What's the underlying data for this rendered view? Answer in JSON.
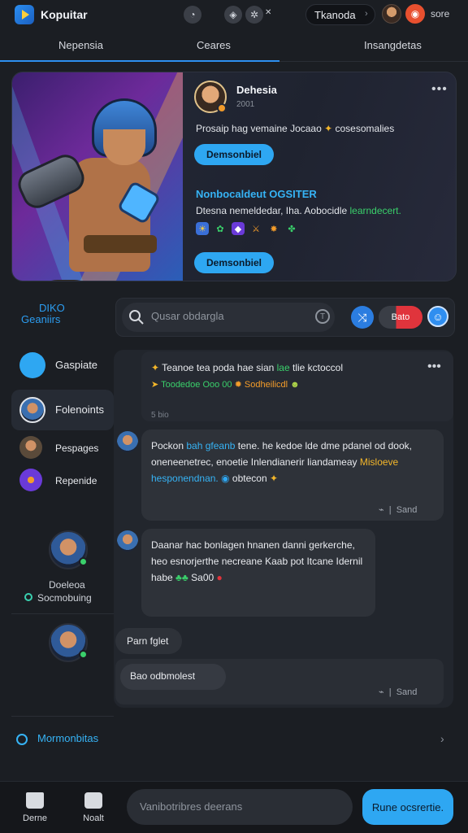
{
  "app": {
    "title": "Kopuitar"
  },
  "topbar": {
    "user_name": "Tkanoda",
    "notif_label": "sore"
  },
  "tabs": [
    {
      "label": "Nepensia"
    },
    {
      "label": "Ceares"
    },
    {
      "label": "Insangdetas"
    }
  ],
  "hero": {
    "name": "Dehesia",
    "sub": "2001",
    "description": "Prosaip hag vemaine Jocaao",
    "description_tail": "cosesomalies",
    "button1": "Demsonbiel",
    "heading2": "Nonbocaldeut OGSITER",
    "line2": "Dtesna nemeldedar, Iha. Aobocidle",
    "line2_highlight": "learndecert.",
    "button2": "Demsonbiel"
  },
  "sidebar": {
    "title_line1": "DIKO",
    "title_line2": "Geaniirs",
    "items": [
      {
        "label": "Gaspiate"
      },
      {
        "label": "Folenoints"
      },
      {
        "label": "Pespages"
      },
      {
        "label": "Repenide"
      }
    ],
    "profile_name": "Doeleoa",
    "profile_status": "Socmobuing"
  },
  "search": {
    "placeholder": "Qusar obdargla",
    "chip_label": "Bato"
  },
  "feed": {
    "top_post": {
      "line1": "Teanoe tea poda hae sian",
      "line1_highlight": "lae",
      "line1_tail": "tlie kctoccol",
      "line2": "Toodedoe Ooo 00",
      "line2_highlight": "Sodheilicdl",
      "time": "5 bio"
    },
    "message1": {
      "line1_a": "Pockon",
      "line1_b": "bah gfeanb",
      "line1_c": "tene. he kedoe lde dme pdanel od dook,",
      "line2_a": "oneneenetrec, enoetie Inlendianerir liandameay",
      "line2_b": "Misloeve",
      "line3": "hesponendnan.",
      "line3_tail": "obtecon",
      "meta": "Sand"
    },
    "message2": {
      "line1": "Daanar hac bonlagen hnanen danni gerkerche,",
      "line2": "heo esnorjerthe necreane Kaab pot Itcane Idernil",
      "line3": "habe",
      "line3_tail": "Sa00"
    },
    "short_msg": "Parn fglet",
    "reply_label": "Bao odbmolest",
    "reply_meta": "Sand"
  },
  "footer": {
    "link": "Mormonbitas"
  },
  "bottombar": {
    "nav": [
      {
        "label": "Derne"
      },
      {
        "label": "Noalt"
      }
    ],
    "compose_placeholder": "Vanibotribres deerans",
    "send_label": "Rune ocsrertie."
  }
}
